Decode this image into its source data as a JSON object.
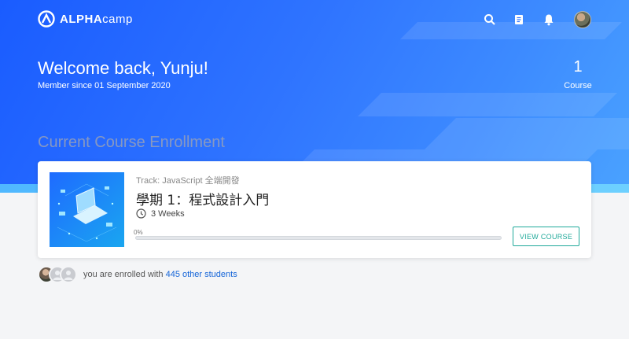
{
  "brand": {
    "name_bold": "ALPHA",
    "name_thin": "camp"
  },
  "topbar": {
    "icons": [
      "search-icon",
      "notebook-icon",
      "bell-icon"
    ],
    "avatar": "user-avatar"
  },
  "hero": {
    "welcome": "Welcome back, Yunju!",
    "member_since": "Member since 01 September 2020",
    "course_count": "1",
    "course_label": "Course"
  },
  "section": {
    "title": "Current Course Enrollment"
  },
  "enrollment": {
    "track": "Track: JavaScript 全端開發",
    "title": "學期 1：程式設計入門",
    "duration": "3 Weeks",
    "progress_label": "0%",
    "progress": 0,
    "button": "VIEW COURSE"
  },
  "students": {
    "prefix": "you are enrolled with",
    "link": "445 other students"
  },
  "colors": {
    "hero": "#1f62ff",
    "accent": "#20a99a",
    "link": "#1565d8"
  }
}
